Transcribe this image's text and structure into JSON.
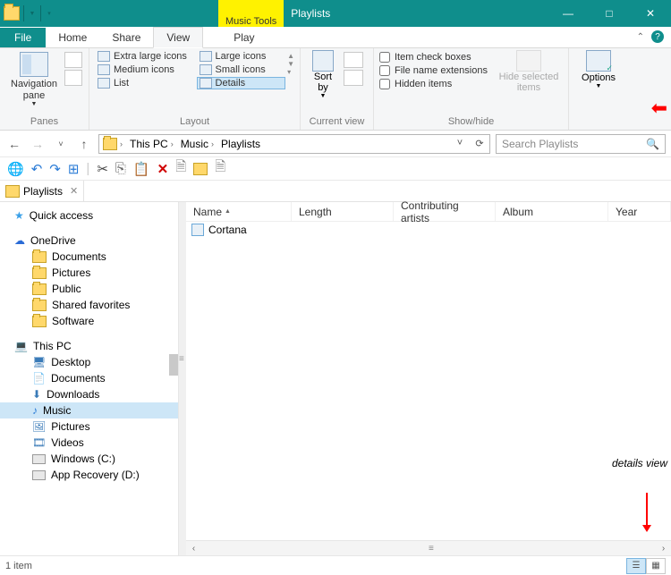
{
  "titlebar": {
    "tools_tab": "Music Tools",
    "title": "Playlists"
  },
  "ribbon_tabs": {
    "file": "File",
    "home": "Home",
    "share": "Share",
    "view": "View",
    "play": "Play"
  },
  "ribbon": {
    "panes": {
      "nav_pane": "Navigation\npane",
      "label": "Panes"
    },
    "layout": {
      "items": {
        "extra_large": "Extra large icons",
        "large": "Large icons",
        "medium": "Medium icons",
        "small": "Small icons",
        "list": "List",
        "details": "Details"
      },
      "label": "Layout"
    },
    "current_view": {
      "sort_by": "Sort\nby",
      "label": "Current view"
    },
    "show_hide": {
      "item_check": "Item check boxes",
      "file_ext": "File name extensions",
      "hidden": "Hidden items",
      "hide_selected": "Hide selected\nitems",
      "label": "Show/hide"
    },
    "options": "Options"
  },
  "addressbar": {
    "segments": [
      "This PC",
      "Music",
      "Playlists"
    ]
  },
  "search": {
    "placeholder": "Search Playlists"
  },
  "folder_tab": "Playlists",
  "tree": {
    "quick_access": "Quick access",
    "onedrive": "OneDrive",
    "onedrive_children": [
      "Documents",
      "Pictures",
      "Public",
      "Shared favorites",
      "Software"
    ],
    "this_pc": "This PC",
    "this_pc_children": [
      "Desktop",
      "Documents",
      "Downloads",
      "Music",
      "Pictures",
      "Videos",
      "Windows (C:)",
      "App Recovery (D:)"
    ]
  },
  "columns": {
    "name": "Name",
    "length": "Length",
    "contrib": "Contributing artists",
    "album": "Album",
    "year": "Year"
  },
  "files": [
    {
      "name": "Cortana"
    }
  ],
  "status": {
    "count": "1 item"
  },
  "annotation": "details view"
}
